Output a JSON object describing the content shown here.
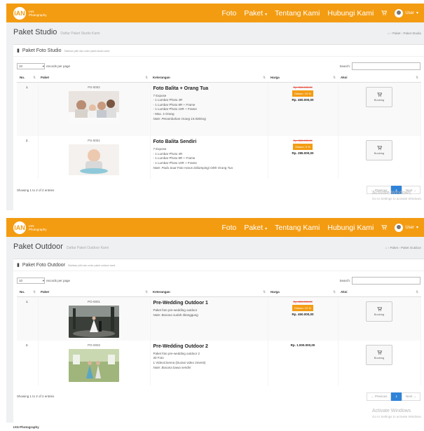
{
  "brand": {
    "mark": "IAN",
    "name": "IAN Photography"
  },
  "nav": {
    "foto": "Foto",
    "paket": "Paket",
    "tentang": "Tentang Kami",
    "hubungi": "Hubungi Kami",
    "user": "User"
  },
  "icons": {
    "cart": "cart-icon",
    "user": "user-avatar-icon",
    "book": "book-icon",
    "home": "home-icon",
    "booking": "cart-icon"
  },
  "colors": {
    "accent": "#f39c12",
    "pager_active": "#2f83d8",
    "old_price": "#e74c3c"
  },
  "table_headers": {
    "no": "No.",
    "paket": "Paket",
    "ket": "Keterangan",
    "harga": "Harga",
    "aksi": "Aksi"
  },
  "controls": {
    "per_page": "10",
    "per_page_label": "records per page",
    "search_label": "Search:",
    "search_value": ""
  },
  "pager": {
    "prev": "← Previous",
    "current": "1",
    "next": "Next →"
  },
  "book_label": "Booking",
  "watermark": {
    "title": "Activate Windows",
    "sub": "Go to Settings to activate Windows."
  },
  "footer": "IAN Photography",
  "studio": {
    "title": "Paket Studio",
    "subtitle": "Daftar Paket Studio Kami",
    "breadcrumb": "⌂ › Paket › Paket Studio",
    "card_title": "Paket Foto Studio",
    "card_sub": "Silahkan pilih dan order paket studio kami",
    "showing": "Showing 1 to 2 of 2 entries",
    "rows": [
      {
        "no": "1.",
        "code": "PS-0002",
        "name": "Foto Balita + Orang Tua",
        "lines": [
          "7 Expose",
          "- 1 Lumbar Photo 4R",
          "- 1 Lumbar Photo 8R + Frame",
          "- 1 Lumbar Photo 10R + Frame",
          "- Max. 4 Orang"
        ],
        "note": "Note: Penambahan Orang 15.000/org",
        "old_price": "Rp. 500.000,00",
        "discount": "Diskon: 10 %",
        "price": "Rp. 450.000,00"
      },
      {
        "no": "2.",
        "code": "PS-0001",
        "name": "Foto Balita Sendiri",
        "lines": [
          "7 Expose",
          "- 1 Lumbar Photo 4R",
          "- 1 Lumbar Photo 8R + Frame",
          "- 1 Lumbar Photo 10R + Frame"
        ],
        "note": "Note: Pada Saat Foto Harus Didampingi Oleh Orang Tua",
        "old_price": "Rp. 300.000,00",
        "discount": "Diskon: 5 %",
        "price": "Rp. 285.000,00"
      }
    ]
  },
  "outdoor": {
    "title": "Paket Outdoor",
    "subtitle": "Daftar Paket Outdoor Kami",
    "breadcrumb": "⌂ › Paket › Paket Outdoor",
    "card_title": "Paket Foto Outdoor",
    "card_sub": "Silahkan pilih dan order paket outdoor kami",
    "showing": "Showing 1 to 2 of 2 entries",
    "rows": [
      {
        "no": "1.",
        "code": "PO-0001",
        "name": "Pre-Wedding Outdoor 1",
        "lines": [
          "Paket foto pre-wedding outdoor"
        ],
        "note": "Note: Busana sudah ditanggung",
        "old_price": "Rp. 500.000,00",
        "discount": "Diskon: 10 %",
        "price": "Rp. 450.000,00"
      },
      {
        "no": "2.",
        "code": "PO-0002",
        "name": "Pre-Wedding Outdoor 2",
        "lines": [
          "Paket foto pre-wedding outdoor 2",
          "30 Foto",
          "1 VideoCinema (Durasi video 2menit)"
        ],
        "note": "Note: Busana bawa sendiri",
        "old_price": "",
        "discount": "",
        "price": "Rp. 1.000.000,00"
      }
    ]
  }
}
